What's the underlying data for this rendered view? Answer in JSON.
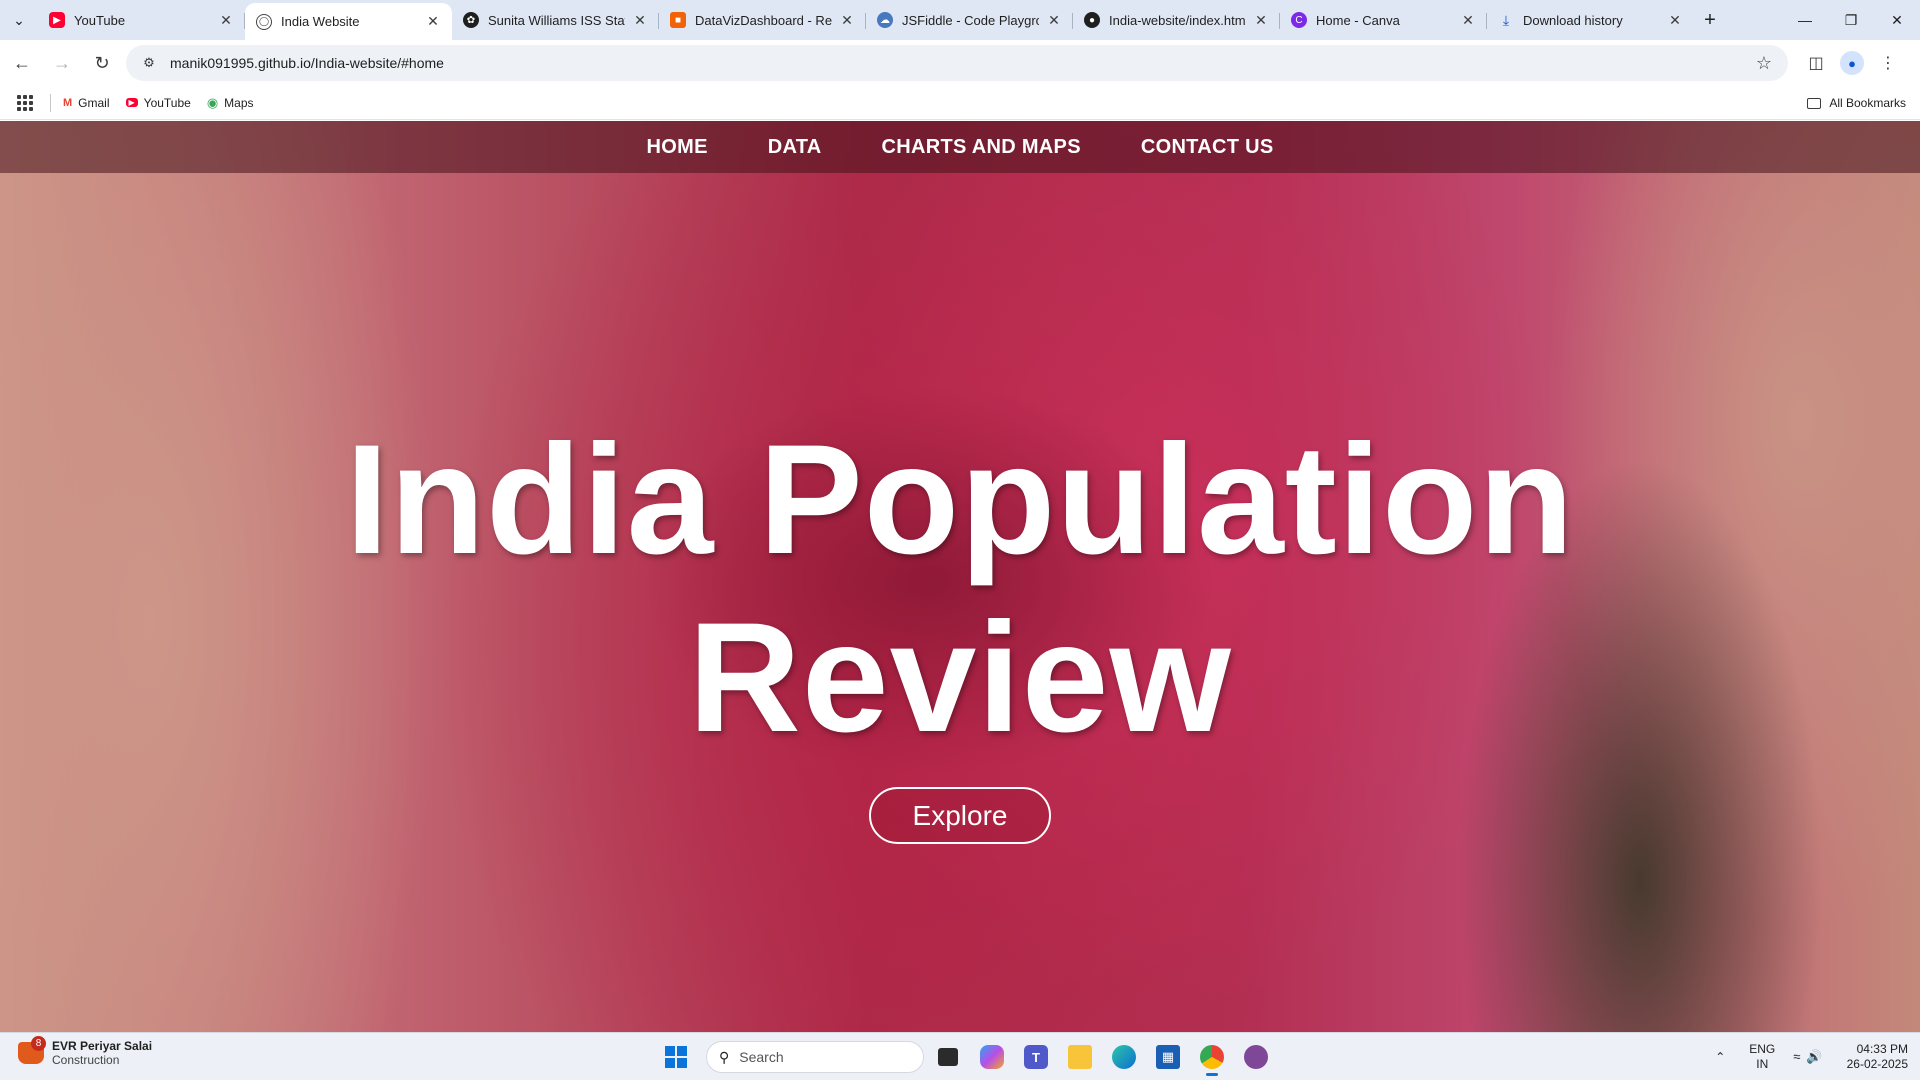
{
  "browser": {
    "tabs": [
      {
        "title": "YouTube",
        "icon": "youtube-icon",
        "active": false
      },
      {
        "title": "India Website",
        "icon": "globe-icon",
        "active": true
      },
      {
        "title": "Sunita Williams ISS Stay",
        "icon": "chatgpt-icon",
        "active": false
      },
      {
        "title": "DataVizDashboard - Repl",
        "icon": "replit-icon",
        "active": false
      },
      {
        "title": "JSFiddle - Code Playgrou",
        "icon": "jsfiddle-icon",
        "active": false
      },
      {
        "title": "India-website/index.html",
        "icon": "github-icon",
        "active": false
      },
      {
        "title": "Home - Canva",
        "icon": "canva-icon",
        "active": false
      },
      {
        "title": "Download history",
        "icon": "download-icon",
        "active": false
      }
    ],
    "url": "manik091995.github.io/India-website/#home",
    "bookmarks": [
      {
        "label": "Gmail",
        "icon": "gmail-icon"
      },
      {
        "label": "YouTube",
        "icon": "youtube-icon"
      },
      {
        "label": "Maps",
        "icon": "maps-icon"
      }
    ],
    "all_bookmarks_label": "All Bookmarks"
  },
  "page": {
    "nav": [
      "HOME",
      "DATA",
      "CHARTS AND MAPS",
      "CONTACT US"
    ],
    "hero_title_line1": "India Population",
    "hero_title_line2": "Review",
    "explore_label": "Explore"
  },
  "taskbar": {
    "weather_badge": "8",
    "weather_title": "EVR Periyar Salai",
    "weather_subtitle": "Construction",
    "search_placeholder": "Search",
    "lang_line1": "ENG",
    "lang_line2": "IN",
    "time": "04:33 PM",
    "date": "26-02-2025"
  },
  "colors": {
    "tabstrip_bg": "#dfe7f5",
    "accent_blue": "#0a74da",
    "hero_overlay": "#8c1432"
  }
}
